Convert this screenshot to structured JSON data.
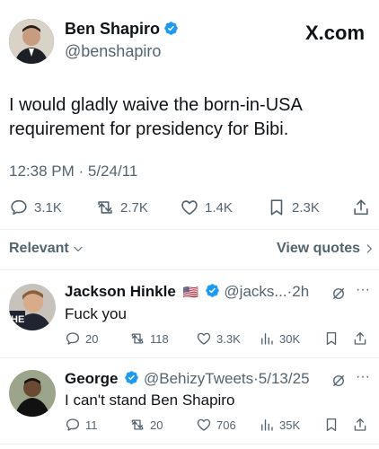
{
  "header": {
    "author_name": "Ben Shapiro",
    "handle": "@benshapiro",
    "brand": "X.com"
  },
  "tweet": {
    "text_line1": "I would gladly waive the born-in-USA",
    "text_line2": "requirement for presidency for Bibi.",
    "timestamp": "12:38 PM · 5/24/11",
    "replies": "3.1K",
    "reposts": "2.7K",
    "likes": "1.4K",
    "bookmarks": "2.3K"
  },
  "sort": {
    "relevant_label": "Relevant",
    "view_quotes_label": "View quotes"
  },
  "replies": [
    {
      "name": "Jackson Hinkle",
      "flag": "🇺🇸",
      "meta": "@jacks...·2h",
      "text": "Fuck you",
      "avatar_label": "HE",
      "comments": "20",
      "reposts": "118",
      "likes": "3.3K",
      "views": "30K"
    },
    {
      "name": "George",
      "meta": "@BehizyTweets·5/13/25",
      "text": "I can't stand Ben Shapiro",
      "comments": "11",
      "reposts": "20",
      "likes": "706",
      "views": "35K"
    }
  ],
  "colors": {
    "verified_blue": "#1d9bf0",
    "text_primary": "#0f1419",
    "text_secondary": "#536471",
    "divider": "#eff3f4"
  }
}
